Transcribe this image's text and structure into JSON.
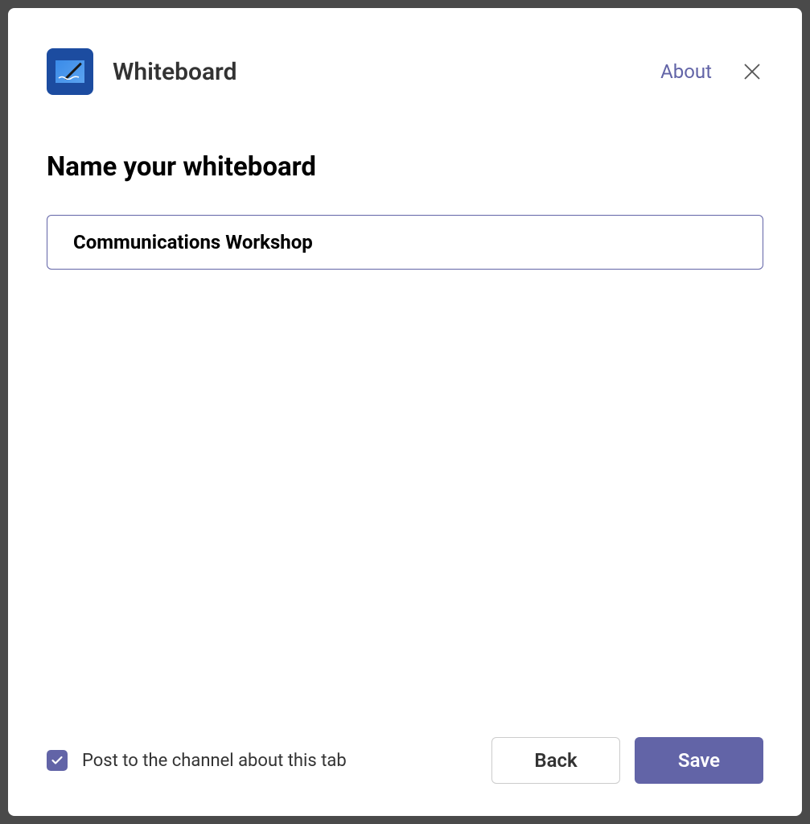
{
  "header": {
    "app_title": "Whiteboard",
    "about_label": "About"
  },
  "content": {
    "section_title": "Name your whiteboard",
    "name_input_value": "Communications Workshop"
  },
  "footer": {
    "checkbox_label": "Post to the channel about this tab",
    "checkbox_checked": true,
    "back_button_label": "Back",
    "save_button_label": "Save"
  },
  "colors": {
    "primary": "#6264a7",
    "icon_bg": "#1c4ca0"
  }
}
